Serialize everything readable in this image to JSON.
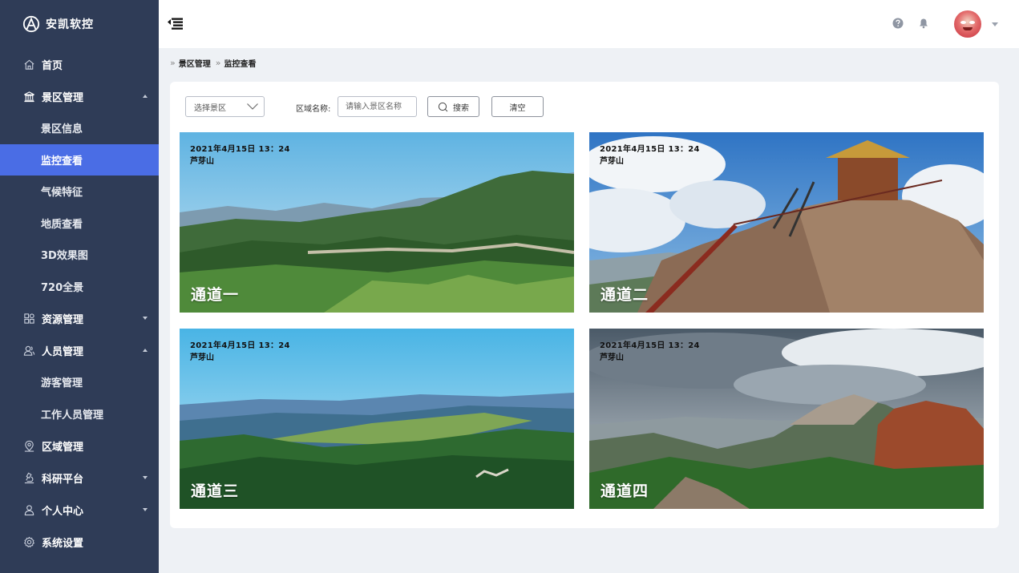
{
  "brand": {
    "name": "安凯软控"
  },
  "sidebar": {
    "items": [
      {
        "label": "首页"
      },
      {
        "label": "景区管理",
        "sub": [
          {
            "label": "景区信息"
          },
          {
            "label": "监控查看"
          },
          {
            "label": "气候特征"
          },
          {
            "label": "地质查看"
          },
          {
            "label": "3D效果图"
          },
          {
            "label": "720全景"
          }
        ]
      },
      {
        "label": "资源管理"
      },
      {
        "label": "人员管理",
        "sub": [
          {
            "label": "游客管理"
          },
          {
            "label": "工作人员管理"
          }
        ]
      },
      {
        "label": "区域管理"
      },
      {
        "label": "科研平台"
      },
      {
        "label": "个人中心"
      },
      {
        "label": "系统设置"
      }
    ],
    "active_item": "监控查看"
  },
  "breadcrumb": [
    "景区管理",
    "监控查看"
  ],
  "filters": {
    "scenic_select": "选择景区",
    "area_label": "区域名称:",
    "area_placeholder": "请输入景区名称",
    "search_label": "搜索",
    "clear_label": "清空"
  },
  "channels": [
    {
      "timestamp": "2021年4月15日  13：24",
      "location": "芦芽山",
      "name": "通道一"
    },
    {
      "timestamp": "2021年4月15日  13：24",
      "location": "芦芽山",
      "name": "通道二"
    },
    {
      "timestamp": "2021年4月15日  13：24",
      "location": "芦芽山",
      "name": "通道三"
    },
    {
      "timestamp": "2021年4月15日  13：24",
      "location": "芦芽山",
      "name": "通道四"
    }
  ],
  "colors": {
    "sidebar_bg": "#2f3c57",
    "active_bg": "#4a6de5",
    "page_bg": "#eef1f5"
  }
}
